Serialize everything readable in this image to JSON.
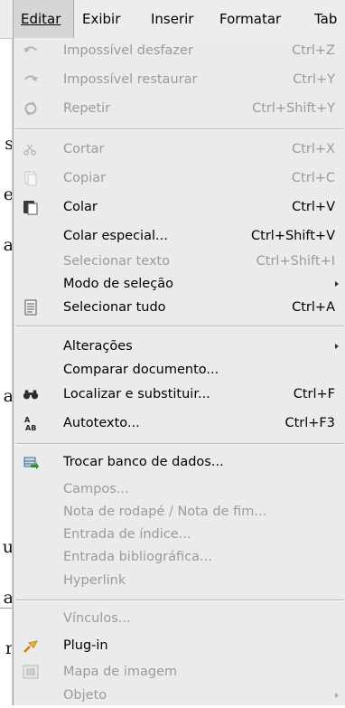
{
  "menubar": {
    "items": [
      {
        "label": "Editar"
      },
      {
        "label": "Exibir"
      },
      {
        "label": "Inserir"
      },
      {
        "label": "Formatar"
      },
      {
        "label": "Tab"
      }
    ]
  },
  "document": {
    "letters": [
      "s",
      "e",
      "a",
      "a",
      "u",
      "a",
      "r"
    ]
  },
  "menu": {
    "items": [
      {
        "label": "Impossível desfazer",
        "shortcut": "Ctrl+Z",
        "icon": "undo-icon",
        "disabled": true
      },
      {
        "label": "Impossível restaurar",
        "shortcut": "Ctrl+Y",
        "icon": "redo-icon",
        "disabled": true
      },
      {
        "label": "Repetir",
        "shortcut": "Ctrl+Shift+Y",
        "icon": "repeat-icon",
        "disabled": true
      },
      {
        "label": "Cortar",
        "shortcut": "Ctrl+X",
        "icon": "scissors-icon",
        "disabled": true
      },
      {
        "label": "Copiar",
        "shortcut": "Ctrl+C",
        "icon": "copy-icon",
        "disabled": true
      },
      {
        "label": "Colar",
        "shortcut": "Ctrl+V",
        "icon": "paste-icon",
        "disabled": false
      },
      {
        "label": "Colar especial...",
        "shortcut": "Ctrl+Shift+V",
        "icon": "",
        "disabled": false
      },
      {
        "label": "Selecionar texto",
        "shortcut": "Ctrl+Shift+I",
        "icon": "",
        "disabled": true
      },
      {
        "label": "Modo de seleção",
        "shortcut": "",
        "icon": "",
        "disabled": false,
        "submenu": true
      },
      {
        "label": "Selecionar tudo",
        "shortcut": "Ctrl+A",
        "icon": "select-all-icon",
        "disabled": false
      },
      {
        "label": "Alterações",
        "shortcut": "",
        "icon": "",
        "disabled": false,
        "submenu": true
      },
      {
        "label": "Comparar documento...",
        "shortcut": "",
        "icon": "",
        "disabled": false
      },
      {
        "label": "Localizar e substituir...",
        "shortcut": "Ctrl+F",
        "icon": "binoculars-icon",
        "disabled": false
      },
      {
        "label": "Autotexto...",
        "shortcut": "Ctrl+F3",
        "icon": "autotext-icon",
        "disabled": false
      },
      {
        "label": "Trocar banco de dados...",
        "shortcut": "",
        "icon": "database-icon",
        "disabled": false
      },
      {
        "label": "Campos...",
        "shortcut": "",
        "icon": "",
        "disabled": true
      },
      {
        "label": "Nota de rodapé / Nota de fim...",
        "shortcut": "",
        "icon": "",
        "disabled": true
      },
      {
        "label": "Entrada de índice...",
        "shortcut": "",
        "icon": "",
        "disabled": true
      },
      {
        "label": "Entrada bibliográfica...",
        "shortcut": "",
        "icon": "",
        "disabled": true
      },
      {
        "label": "Hyperlink",
        "shortcut": "",
        "icon": "",
        "disabled": true
      },
      {
        "label": "Vínculos...",
        "shortcut": "",
        "icon": "",
        "disabled": true
      },
      {
        "label": "Plug-in",
        "shortcut": "",
        "icon": "plugin-icon",
        "disabled": false
      },
      {
        "label": "Mapa de imagem",
        "shortcut": "",
        "icon": "image-map-icon",
        "disabled": true
      },
      {
        "label": "Objeto",
        "shortcut": "",
        "icon": "",
        "disabled": true,
        "submenu": true
      }
    ]
  },
  "colors": {
    "menu_bg": "#ebebeb",
    "disabled_text": "#9b9b9b",
    "active_menubar": "#d6d6d6"
  }
}
